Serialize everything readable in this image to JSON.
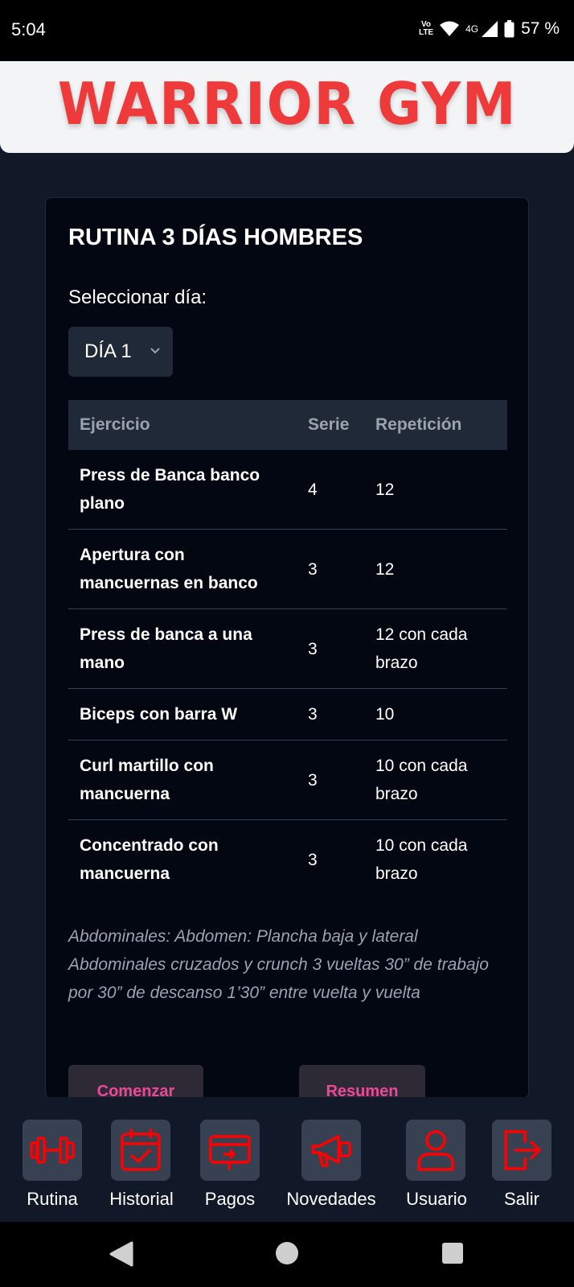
{
  "status_bar": {
    "time": "5:04",
    "volte_top": "Vo",
    "volte_bottom": "LTE",
    "network": "4G",
    "battery": "57 %"
  },
  "brand": {
    "logo_text": "WARRIOR GYM",
    "logo_color": "#ee3a3a"
  },
  "routine": {
    "title": "RUTINA 3 DÍAS HOMBRES",
    "select_label": "Seleccionar día:",
    "selected_day": "DÍA 1",
    "columns": [
      "Ejercicio",
      "Serie",
      "Repetición"
    ],
    "rows": [
      {
        "exercise": "Press de Banca banco plano",
        "sets": "4",
        "reps": "12"
      },
      {
        "exercise": "Apertura con mancuernas en banco",
        "sets": "3",
        "reps": "12"
      },
      {
        "exercise": "Press de banca a una mano",
        "sets": "3",
        "reps": "12 con cada brazo"
      },
      {
        "exercise": "Biceps con barra W",
        "sets": "3",
        "reps": "10"
      },
      {
        "exercise": "Curl martillo con mancuerna",
        "sets": "3",
        "reps": "10 con cada brazo"
      },
      {
        "exercise": "Concentrado con mancuerna",
        "sets": "3",
        "reps": "10 con cada brazo"
      }
    ],
    "abs_note": "Abdominales: Abdomen: Plancha baja y lateral Abdominales cruzados y crunch 3 vueltas 30” de trabajo por 30” de descanso 1’30” entre vuelta y vuelta",
    "start_button": "Comenzar",
    "summary_button": "Resumen"
  },
  "bottom_nav": [
    {
      "label": "Rutina",
      "icon": "dumbbell-icon"
    },
    {
      "label": "Historial",
      "icon": "calendar-check-icon"
    },
    {
      "label": "Pagos",
      "icon": "payment-card-icon"
    },
    {
      "label": "Novedades",
      "icon": "megaphone-icon"
    },
    {
      "label": "Usuario",
      "icon": "user-icon"
    },
    {
      "label": "Salir",
      "icon": "logout-icon"
    }
  ],
  "colors": {
    "background": "#111827",
    "card": "#030712",
    "accent_pink": "#ec4899",
    "icon_red": "#ff0000",
    "header_bg": "#f3f4f6"
  }
}
